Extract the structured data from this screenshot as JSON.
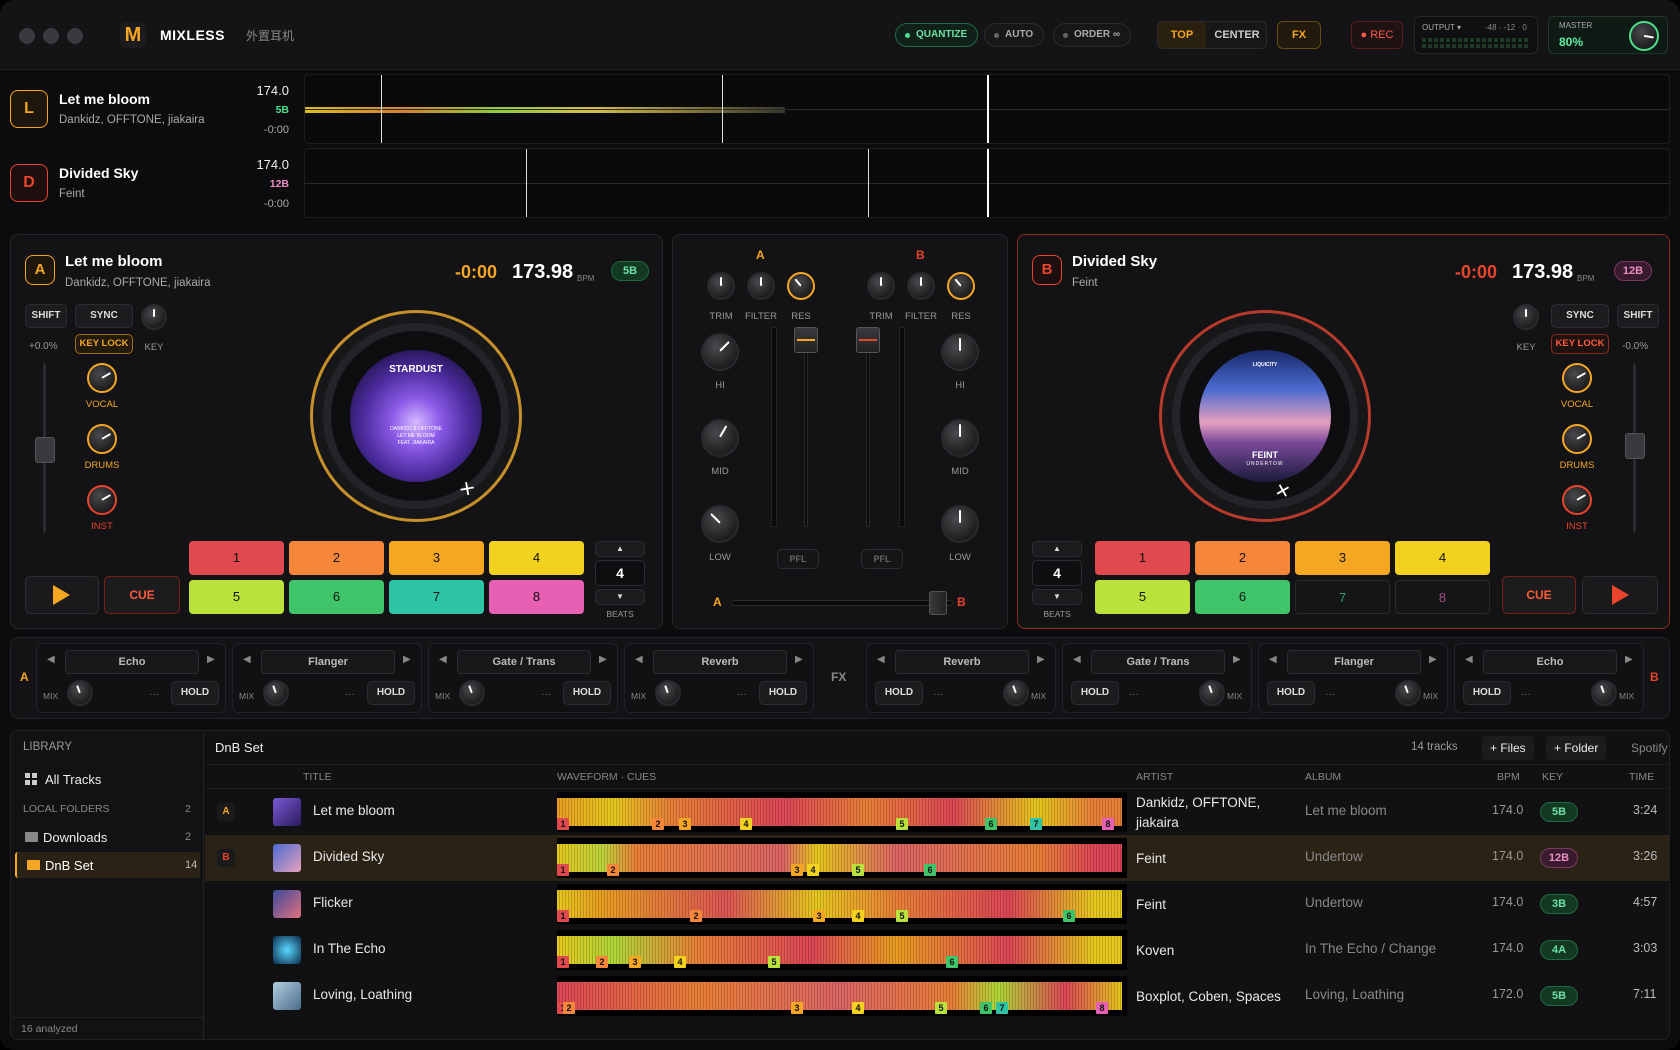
{
  "app": {
    "name": "MIXLESS",
    "device": "外置耳机"
  },
  "header": {
    "quantize": "QUANTIZE",
    "auto": "AUTO",
    "order": "ORDER ∞",
    "view_top": "TOP",
    "view_center": "CENTER",
    "fx": "FX",
    "rec": "● REC",
    "output_label": "OUTPUT ▾",
    "output_scale": "-48 · -12 · 0",
    "master_label": "MASTER",
    "master_value": "80%",
    "master_level": 0.8
  },
  "overview": [
    {
      "deck": "L",
      "title": "Let me bloom",
      "artist": "Dankidz, OFFTONE, jiakaira",
      "bpm": "174.0",
      "key": "5B",
      "time": "-0:00"
    },
    {
      "deck": "D",
      "title": "Divided Sky",
      "artist": "Feint",
      "bpm": "174.0",
      "key": "12B",
      "time": "-0:00"
    }
  ],
  "deck_a": {
    "letter": "A",
    "title": "Let me bloom",
    "artist": "Dankidz, OFFTONE, jiakaira",
    "remaining": "-0:00",
    "bpm": "173.98",
    "bpm_unit": "BPM",
    "key": "5B",
    "shift": "SHIFT",
    "sync": "SYNC",
    "key_lock": "KEY LOCK",
    "key_label": "KEY",
    "pitch": "+0.0%",
    "vocal": "VOCAL",
    "drums": "DRUMS",
    "inst": "INST",
    "cue": "CUE",
    "beats": "4",
    "beats_label": "BEATS",
    "up": "▲",
    "down": "▼",
    "art_title": "STARDUST",
    "art_sub1": "DANKIDZ & OFFTONE",
    "art_sub2": "LET ME BLOOM",
    "art_sub3": "FEAT. JIAKAIRA"
  },
  "deck_b": {
    "letter": "B",
    "title": "Divided Sky",
    "artist": "Feint",
    "remaining": "-0:00",
    "bpm": "173.98",
    "bpm_unit": "BPM",
    "key": "12B",
    "shift": "SHIFT",
    "sync": "SYNC",
    "key_lock": "KEY LOCK",
    "key_label": "KEY",
    "pitch": "-0.0%",
    "vocal": "VOCAL",
    "drums": "DRUMS",
    "inst": "INST",
    "cue": "CUE",
    "beats": "4",
    "beats_label": "BEATS",
    "up": "▲",
    "down": "▼",
    "art_brand": "LIQUICITY",
    "art_title": "FEINT",
    "art_sub": "UNDERTOW"
  },
  "pads": [
    "1",
    "2",
    "3",
    "4",
    "5",
    "6",
    "7",
    "8"
  ],
  "mixer": {
    "a": "A",
    "b": "B",
    "trim": "TRIM",
    "filter": "FILTER",
    "res": "RES",
    "hi": "HI",
    "mid": "MID",
    "low": "LOW",
    "pfl": "PFL"
  },
  "fx": {
    "label": "FX",
    "a": "A",
    "b": "B",
    "mix": "MIX",
    "hold": "HOLD",
    "more": "···",
    "units": [
      "Echo",
      "Flanger",
      "Gate / Trans",
      "Reverb",
      "Reverb",
      "Gate / Trans",
      "Flanger",
      "Echo"
    ]
  },
  "library": {
    "heading": "LIBRARY",
    "all_tracks": "All Tracks",
    "local_folders": "LOCAL FOLDERS",
    "local_count": "2",
    "folders": [
      {
        "name": "Downloads",
        "count": "2"
      },
      {
        "name": "DnB Set",
        "count": "14"
      }
    ],
    "footer": "16 analyzed",
    "current": "DnB Set",
    "track_count": "14 tracks",
    "add_files": "+ Files",
    "add_folder": "+ Folder",
    "spotify": "Spotify",
    "columns": {
      "title": "TITLE",
      "waveform": "WAVEFORM · CUES",
      "artist": "ARTIST",
      "album": "ALBUM",
      "bpm": "BPM",
      "key": "KEY",
      "time": "TIME"
    },
    "tracks": [
      {
        "deck": "A",
        "title": "Let me bloom",
        "artist": "Dankidz, OFFTONE, jiakaira",
        "album": "Let me bloom",
        "bpm": "174.0",
        "key": "5B",
        "time": "3:24",
        "cues": [
          [
            "1",
            0.0
          ],
          [
            "2",
            0.17
          ],
          [
            "3",
            0.22
          ],
          [
            "4",
            0.33
          ],
          [
            "5",
            0.61
          ],
          [
            "6",
            0.77
          ],
          [
            "7",
            0.85
          ],
          [
            "8",
            0.98
          ]
        ]
      },
      {
        "deck": "B",
        "title": "Divided Sky",
        "artist": "Feint",
        "album": "Undertow",
        "bpm": "174.0",
        "key": "12B",
        "time": "3:26",
        "cues": [
          [
            "1",
            0.0
          ],
          [
            "2",
            0.09
          ],
          [
            "3",
            0.42
          ],
          [
            "4",
            0.45
          ],
          [
            "5",
            0.53
          ],
          [
            "6",
            0.66
          ]
        ]
      },
      {
        "deck": "",
        "title": "Flicker",
        "artist": "Feint",
        "album": "Undertow",
        "bpm": "174.0",
        "key": "3B",
        "time": "4:57",
        "cues": [
          [
            "1",
            0.0
          ],
          [
            "2",
            0.24
          ],
          [
            "3",
            0.46
          ],
          [
            "4",
            0.53
          ],
          [
            "5",
            0.61
          ],
          [
            "6",
            0.91
          ]
        ]
      },
      {
        "deck": "",
        "title": "In The Echo",
        "artist": "Koven",
        "album": "In The Echo / Change",
        "bpm": "174.0",
        "key": "4A",
        "time": "3:03",
        "cues": [
          [
            "1",
            0.0
          ],
          [
            "2",
            0.07
          ],
          [
            "3",
            0.13
          ],
          [
            "4",
            0.21
          ],
          [
            "5",
            0.38
          ],
          [
            "6",
            0.7
          ]
        ]
      },
      {
        "deck": "",
        "title": "Loving, Loathing",
        "artist": "Boxplot, Coben, Spaces",
        "album": "Loving, Loathing",
        "bpm": "172.0",
        "key": "5B",
        "time": "7:11",
        "cues": [
          [
            "1",
            0.0
          ],
          [
            "2",
            0.01
          ],
          [
            "3",
            0.42
          ],
          [
            "4",
            0.53
          ],
          [
            "5",
            0.68
          ],
          [
            "6",
            0.76
          ],
          [
            "7",
            0.79
          ],
          [
            "8",
            0.97
          ]
        ]
      }
    ]
  },
  "colors": {
    "deck_a": "#f5a623",
    "deck_b": "#e8452c",
    "pads": [
      "#e04a4e",
      "#f5863a",
      "#f5a623",
      "#f2d21f",
      "#b9e33a",
      "#3fc46a",
      "#2ec4a6",
      "#e65fb3"
    ],
    "key_green": "#4ce08a",
    "key_pink": "#e98fc3"
  }
}
